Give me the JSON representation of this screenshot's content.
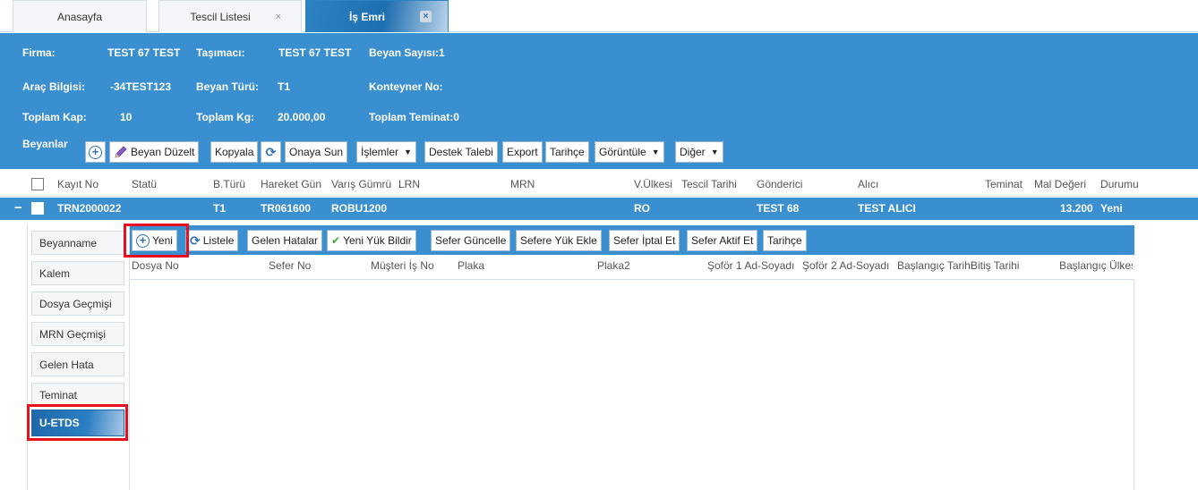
{
  "tabs": [
    {
      "label": "Anasayfa"
    },
    {
      "label": "Tescil Listesi",
      "close": "×"
    },
    {
      "label": "İş Emri",
      "close": "×"
    }
  ],
  "header": {
    "firma_label": "Firma:",
    "firma_value": "TEST 67 TEST",
    "tasimaci_label": "Taşımacı:",
    "tasimaci_value": "TEST 67 TEST",
    "beyan_sayisi": "Beyan Sayısı:1",
    "arac_label": "Araç Bilgisi:",
    "arac_value": "-34TEST123",
    "beyan_turu_label": "Beyan Türü:",
    "beyan_turu_value": "T1",
    "konteyner": "Konteyner No:",
    "toplam_kap_label": "Toplam Kap:",
    "toplam_kap_value": "10",
    "toplam_kg_label": "Toplam Kg:",
    "toplam_kg_value": "20.000,00",
    "toplam_teminat": "Toplam Teminat:0"
  },
  "toolbar": {
    "beyanlar": "Beyanlar",
    "beyan_duzelt": "Beyan Düzelt",
    "kopyala": "Kopyala",
    "onaya_sun": "Onaya Sun",
    "islemler": "İşlemler",
    "destek": "Destek Talebi",
    "export": "Export",
    "tarihce": "Tarihçe",
    "goruntule": "Görüntüle",
    "diger": "Diğer"
  },
  "grid": {
    "columns": [
      "Kayıt No",
      "Statü",
      "B.Türü",
      "Hareket Gün",
      "Varış Gümrü",
      "LRN",
      "MRN",
      "V.Ülkesi",
      "Tescil Tarihi",
      "Gönderici",
      "Alıcı",
      "Teminat",
      "Mal Değeri",
      "Durumu"
    ],
    "row": {
      "kayit_no": "TRN2000022",
      "b_turu": "T1",
      "hareket": "TR061600",
      "varis": "ROBU1200",
      "v_ulkesi": "RO",
      "gonderici": "TEST 68",
      "alici": "TEST ALICI",
      "mal_degeri": "13.200",
      "durumu": "Yeni"
    }
  },
  "side_menu": [
    "Beyanname",
    "Kalem",
    "Dosya Geçmişi",
    "MRN Geçmişi",
    "Gelen Hata",
    "Teminat",
    "U-ETDS"
  ],
  "detail_toolbar": {
    "yeni": "Yeni",
    "listele": "Listele",
    "gelen_hatalar": "Gelen Hatalar",
    "yeni_yuk_bildir": "Yeni Yük Bildir",
    "sefer_guncelle": "Sefer Güncelle",
    "sefere_yuk_ekle": "Sefere Yük Ekle",
    "sefer_iptal": "Sefer İptal Et",
    "sefer_aktif": "Sefer Aktif Et",
    "tarihce": "Tarihçe"
  },
  "detail_columns": [
    "Dosya No",
    "Sefer No",
    "Müşteri İş No",
    "Plaka",
    "Plaka2",
    "Şoför 1 Ad-Soyadı",
    "Şoför 2 Ad-Soyadı",
    "Başlangıç Tarihi",
    "Bitiş Tarihi",
    "Başlangıç Ülkesi"
  ],
  "colors": {
    "header_blue": "#3a8fd0",
    "highlight_red": "#e8101e"
  }
}
